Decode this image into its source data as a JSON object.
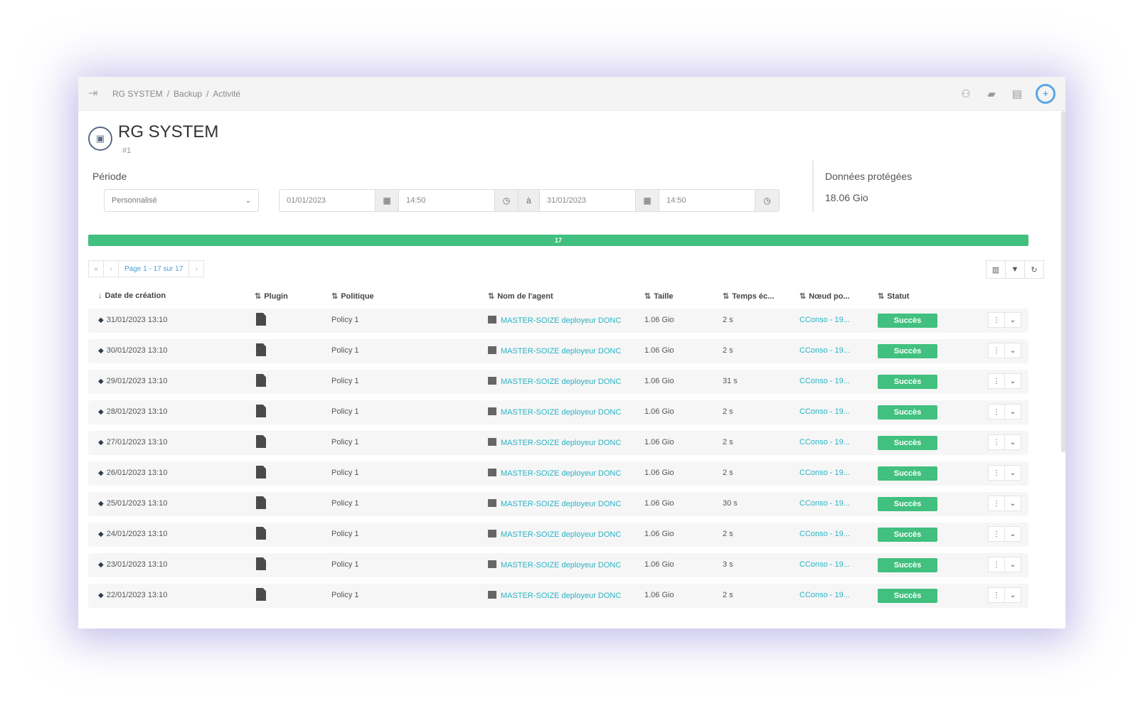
{
  "breadcrumb": [
    "RG SYSTEM",
    "Backup",
    "Activité"
  ],
  "header": {
    "title": "RG SYSTEM",
    "subtitle": "#1"
  },
  "icons": {
    "menu": "sidebar-toggle-icon",
    "top": [
      "contacts-icon",
      "chat-icon",
      "document-icon",
      "help-lifebuoy-icon"
    ]
  },
  "filters": {
    "period_label": "Période",
    "period_value": "Personnalisé",
    "from_date": "01/01/2023",
    "from_time": "14:50",
    "to_label": "à",
    "to_date": "31/01/2023",
    "to_time": "14:50"
  },
  "protected": {
    "label": "Données protégées",
    "value": "18.06 Gio"
  },
  "progress": {
    "label": "17",
    "fraction": 1.0
  },
  "pager": {
    "first": "«",
    "prev": "‹",
    "info": "Page 1 - 17 sur 17",
    "next": "›"
  },
  "table": {
    "columns": [
      "Date de création",
      "Plugin",
      "Politique",
      "Nom de l'agent",
      "Taille",
      "Temps éc...",
      "Nœud po...",
      "Statut"
    ],
    "rows": [
      {
        "date": "31/01/2023 13:10",
        "policy": "Policy 1",
        "agent": "MASTER-SOIZE deployeur DONC",
        "size": "1.06 Gio",
        "time": "2 s",
        "node": "CConso - 19...",
        "status": "Succès"
      },
      {
        "date": "30/01/2023 13:10",
        "policy": "Policy 1",
        "agent": "MASTER-SOIZE deployeur DONC",
        "size": "1.06 Gio",
        "time": "2 s",
        "node": "CConso - 19...",
        "status": "Succès"
      },
      {
        "date": "29/01/2023 13:10",
        "policy": "Policy 1",
        "agent": "MASTER-SOIZE deployeur DONC",
        "size": "1.06 Gio",
        "time": "31 s",
        "node": "CConso - 19...",
        "status": "Succès"
      },
      {
        "date": "28/01/2023 13:10",
        "policy": "Policy 1",
        "agent": "MASTER-SOIZE deployeur DONC",
        "size": "1.06 Gio",
        "time": "2 s",
        "node": "CConso - 19...",
        "status": "Succès"
      },
      {
        "date": "27/01/2023 13:10",
        "policy": "Policy 1",
        "agent": "MASTER-SOIZE deployeur DONC",
        "size": "1.06 Gio",
        "time": "2 s",
        "node": "CConso - 19...",
        "status": "Succès"
      },
      {
        "date": "26/01/2023 13:10",
        "policy": "Policy 1",
        "agent": "MASTER-SOIZE deployeur DONC",
        "size": "1.06 Gio",
        "time": "2 s",
        "node": "CConso - 19...",
        "status": "Succès"
      },
      {
        "date": "25/01/2023 13:10",
        "policy": "Policy 1",
        "agent": "MASTER-SOIZE deployeur DONC",
        "size": "1.06 Gio",
        "time": "30 s",
        "node": "CConso - 19...",
        "status": "Succès"
      },
      {
        "date": "24/01/2023 13:10",
        "policy": "Policy 1",
        "agent": "MASTER-SOIZE deployeur DONC",
        "size": "1.06 Gio",
        "time": "2 s",
        "node": "CConso - 19...",
        "status": "Succès"
      },
      {
        "date": "23/01/2023 13:10",
        "policy": "Policy 1",
        "agent": "MASTER-SOIZE deployeur DONC",
        "size": "1.06 Gio",
        "time": "3 s",
        "node": "CConso - 19...",
        "status": "Succès"
      },
      {
        "date": "22/01/2023 13:10",
        "policy": "Policy 1",
        "agent": "MASTER-SOIZE deployeur DONC",
        "size": "1.06 Gio",
        "time": "2 s",
        "node": "CConso - 19...",
        "status": "Succès"
      }
    ]
  },
  "colors": {
    "success": "#41c07f",
    "link": "#29b3c6",
    "help": "#5aa7e6"
  }
}
